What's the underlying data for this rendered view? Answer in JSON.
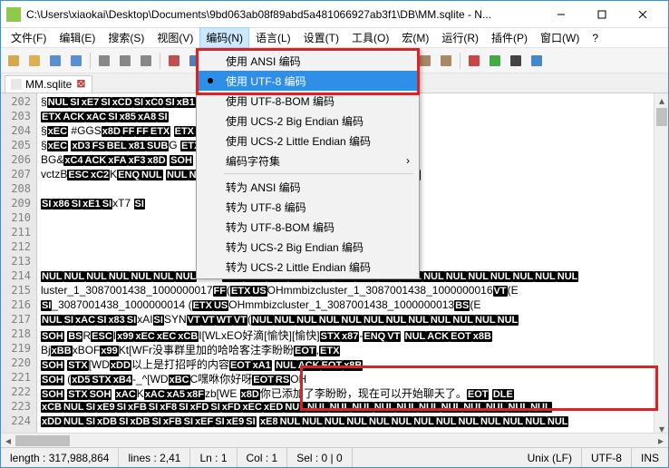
{
  "window": {
    "title": "C:\\Users\\xiaokai\\Desktop\\Documents\\9bd063ab08f89abd5a481066927ab3f1\\DB\\MM.sqlite - N..."
  },
  "menubar": {
    "items": [
      "文件(F)",
      "编辑(E)",
      "搜索(S)",
      "视图(V)",
      "编码(N)",
      "语言(L)",
      "设置(T)",
      "工具(O)",
      "宏(M)",
      "运行(R)",
      "插件(P)",
      "窗口(W)",
      "?"
    ],
    "open_index": 4
  },
  "dropdown": {
    "items_top": [
      {
        "label": "使用 ANSI 编码",
        "selected": false
      },
      {
        "label": "使用 UTF-8 编码",
        "selected": true
      },
      {
        "label": "使用 UTF-8-BOM 编码",
        "selected": false
      },
      {
        "label": "使用 UCS-2 Big Endian 编码",
        "selected": false
      },
      {
        "label": "使用 UCS-2 Little Endian 编码",
        "selected": false
      },
      {
        "label": "编码字符集",
        "selected": false,
        "submenu": true
      }
    ],
    "items_bottom": [
      {
        "label": "转为 ANSI 编码"
      },
      {
        "label": "转为 UTF-8 编码"
      },
      {
        "label": "转为 UTF-8-BOM 编码"
      },
      {
        "label": "转为 UCS-2 Big Endian 编码"
      },
      {
        "label": "转为 UCS-2 Little Endian 编码"
      }
    ]
  },
  "tab": {
    "label": "MM.sqlite"
  },
  "gutter": {
    "start": 202,
    "end": 224
  },
  "lines": [
    "§NULSIxE7SIxCDSIxC0SIxB1SIxEASIxE4SIxC0SIxB2SIx93SIxF4SIx",
    "ETXACKxACSIx85xA8SI",
    "§xEC #GGSx8DFFFFETX                              ETXACKSOHM%xF0OPvxC1x",
    "§xEC xD3FSBELx81SUBG                         ETXx8BFSETXACKSOHK%vT xE7xD6xB0",
    "BG&xC4ACKxFAxF3x8D                                              SOH",
    "vctzBESCxC2KENQNUL              NULNULNULSIxFBNULNULNULNULNULNULNUL",
    "",
    "SIx86SIxE1SIxT7                                   SI",
    "",
    "",
    "",
    "",
    "NULNULNULNULNULNULNULN         ULNULNULNULNULNULNULNULNULNULNULNULNULNULNULNULNUL",
    "luster_1_3087001438_1000000017FF(ETXUSOHmmbizcluster_1_3087001438_1000000016VT(E",
    "SI_3087001438_1000000014      (ETXUSOHmmbizcluster_1_3087001438_1000000013BS(E",
    "NULSIxACSIx83SIxAISISYNVTVTWTVT(NULNULNULNULNULNULNULNULNULNULNULNUL",
    "SOH       BSRESCIx99xECxECxCBI[WLxEO好滴[愉快][愉快]STXx87-ENQVT    NULACKEOTx8B",
    "         BjxBBxBOFx99Kt[WFr没事群里加的哈哈客注李盼盼EOT,ETX",
    "SOH   STX[WDxDD以上是打招呼的内容EOTxA1           NULACKEOTx8B",
    "SOH         (xD5STXxB4-_^[WDxBCC嘿咻你好呀EOTRSOH",
    "SOH   STXSOH xACKxACxA5x8Fzb[WE x8D你已添加了李盼盼，现在可以开始聊天了。EOT DLE",
    "xCBNULSIxE9SIxFBSIxF8SIxFDSIxFDxECxEDNULNULNULNULNULNULNULNULNULNULNULNUL",
    "xDDNULSIxDBSIxDBSIxFBSIxEFSIxE9SI xE8NULNULNULNULNULNULNULNULNULNULNULNULNUL"
  ],
  "status": {
    "length": "length : 317,988,864",
    "lines": "lines : 2,41",
    "ln": "Ln : 1",
    "col": "Col : 1",
    "sel": "Sel : 0 | 0",
    "eol": "Unix (LF)",
    "enc": "UTF-8",
    "ovr": "INS"
  },
  "icons": {
    "toolbar": [
      "new",
      "open",
      "save",
      "save-all",
      "close",
      "close-all",
      "print",
      "cut",
      "copy",
      "paste",
      "undo",
      "redo",
      "find",
      "replace",
      "zoom-in",
      "zoom-out",
      "wrap",
      "show-all",
      "indent",
      "outdent",
      "macro-rec",
      "macro-play",
      "macro-stop",
      "macro-multi"
    ]
  }
}
